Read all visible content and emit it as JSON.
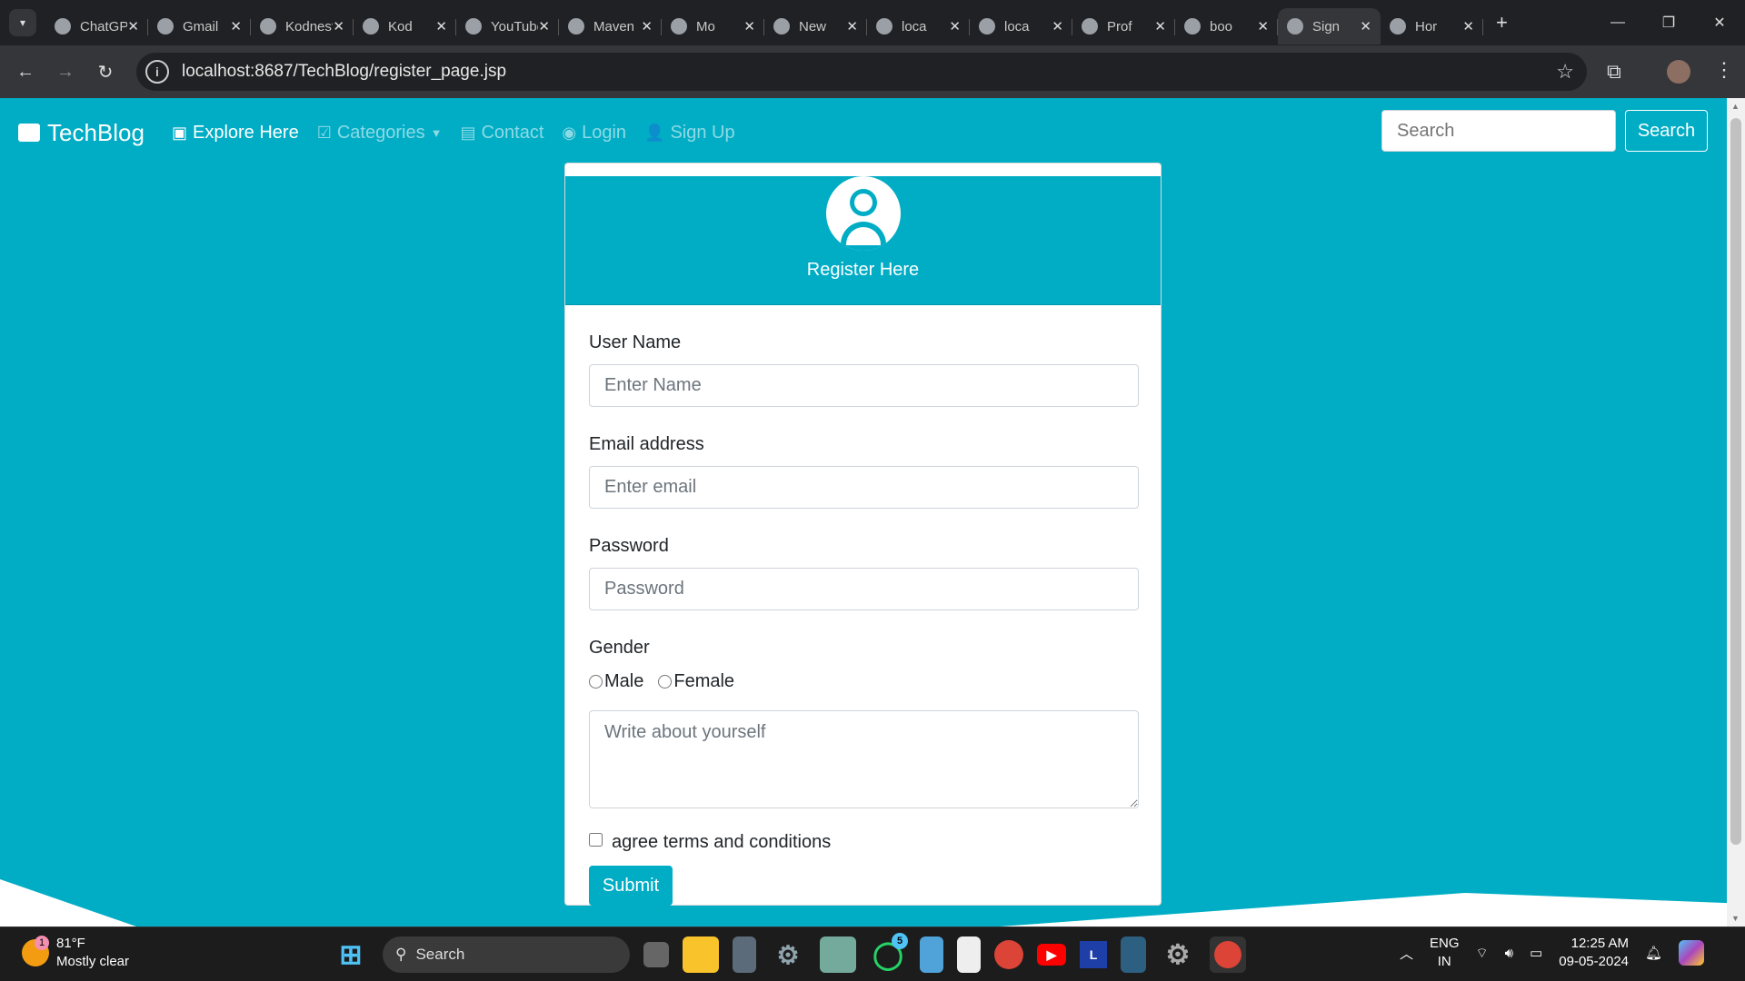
{
  "browser": {
    "tabs": [
      {
        "title": "ChatGPT",
        "icon": "chatgpt-icon"
      },
      {
        "title": "Gmail",
        "icon": "gmail-icon"
      },
      {
        "title": "Kodnest",
        "icon": "k-icon"
      },
      {
        "title": "Kod",
        "icon": "globe-icon"
      },
      {
        "title": "YouTube",
        "icon": "youtube-icon"
      },
      {
        "title": "Maven",
        "icon": "maven-icon"
      },
      {
        "title": "Mo",
        "icon": "github-icon"
      },
      {
        "title": "New",
        "icon": "chrome-icon"
      },
      {
        "title": "loca",
        "icon": "globe-icon"
      },
      {
        "title": "loca",
        "icon": "globe-icon"
      },
      {
        "title": "Prof",
        "icon": "globe-icon"
      },
      {
        "title": "boo",
        "icon": "google-icon"
      },
      {
        "title": "Sign",
        "icon": "globe-icon",
        "active": true
      },
      {
        "title": "Hor",
        "icon": "globe-icon"
      }
    ],
    "url": "localhost:8687/TechBlog/register_page.jsp"
  },
  "navbar": {
    "brand": "TechBlog",
    "links": [
      "Explore Here",
      "Categories",
      "Contact",
      "Login",
      "Sign Up"
    ],
    "search_placeholder": "Search",
    "search_button": "Search"
  },
  "form": {
    "title": "Register Here",
    "username_label": "User Name",
    "username_placeholder": "Enter Name",
    "email_label": "Email address",
    "email_placeholder": "Enter email",
    "password_label": "Password",
    "password_placeholder": "Password",
    "gender_label": "Gender",
    "male": "Male",
    "female": "Female",
    "about_placeholder": "Write about yourself",
    "terms": "agree terms and conditions",
    "submit": "Submit"
  },
  "taskbar": {
    "weather_temp": "81°F",
    "weather_desc": "Mostly clear",
    "weather_badge": "1",
    "search": "Search",
    "whatsapp_badge": "5",
    "lang1": "ENG",
    "lang2": "IN",
    "time": "12:25 AM",
    "date": "09-05-2024"
  },
  "colors": {
    "accent": "#00adc5"
  }
}
